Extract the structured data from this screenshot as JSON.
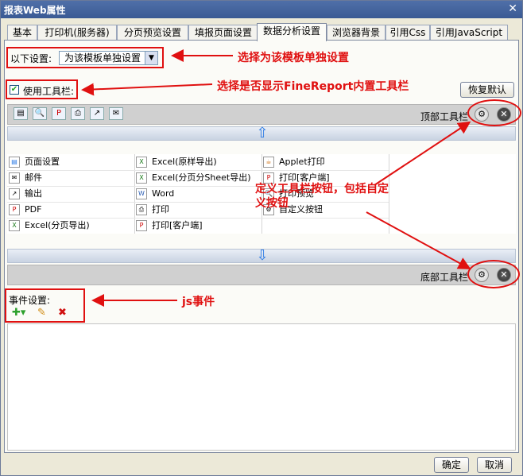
{
  "window": {
    "title": "报表Web属性"
  },
  "tabs": [
    {
      "label": "基本"
    },
    {
      "label": "打印机(服务器)"
    },
    {
      "label": "分页预览设置"
    },
    {
      "label": "填报页面设置"
    },
    {
      "label": "数据分析设置"
    },
    {
      "label": "浏览器背景"
    },
    {
      "label": "引用Css"
    },
    {
      "label": "引用JavaScript"
    }
  ],
  "settings": {
    "scope_label": "以下设置:",
    "scope_value": "为该模板单独设置",
    "use_toolbar_label": "使用工具栏:",
    "restore_default": "恢复默认"
  },
  "top_toolbar": {
    "label": "顶部工具栏"
  },
  "bottom_toolbar": {
    "label": "底部工具栏"
  },
  "toolbar_items": {
    "col1": [
      "页面设置",
      "邮件",
      "输出",
      "PDF",
      "Excel(分页导出)"
    ],
    "col2": [
      "Excel(原样导出)",
      "Excel(分页分Sheet导出)",
      "Word",
      "打印",
      "打印[客户端]"
    ],
    "col3": [
      "Applet打印",
      "打印[客户端]",
      "打印预览",
      "自定义按钮"
    ]
  },
  "events": {
    "label": "事件设置:"
  },
  "footer": {
    "ok": "确定",
    "cancel": "取消"
  },
  "annotations": {
    "scope": "选择为该模板单独设置",
    "toolbar": "选择是否显示FineReport内置工具栏",
    "custom": "定义工具栏按钮，包括自定义按钮",
    "js": "js事件"
  },
  "colors": {
    "annotation": "#e01010",
    "accent": "#2c7be5"
  }
}
